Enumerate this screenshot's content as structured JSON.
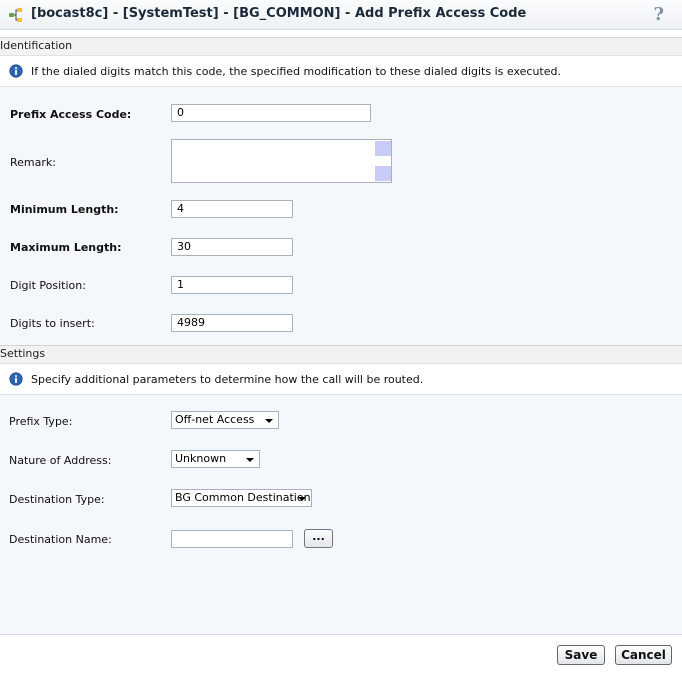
{
  "window": {
    "title": "[bocast8c] - [SystemTest] - [BG_COMMON] - Add Prefix Access Code",
    "help_symbol": "?"
  },
  "identification": {
    "header": "Identification",
    "info": "If the dialed digits match this code, the specified modification to these dialed digits is executed.",
    "prefix_access_code": {
      "label": "Prefix Access Code:",
      "value": "0"
    },
    "remark": {
      "label": "Remark:",
      "value": ""
    },
    "minimum_length": {
      "label": "Minimum Length:",
      "value": "4"
    },
    "maximum_length": {
      "label": "Maximum Length:",
      "value": "30"
    },
    "digit_position": {
      "label": "Digit Position:",
      "value": "1"
    },
    "digits_to_insert": {
      "label": "Digits to insert:",
      "value": "4989"
    }
  },
  "settings": {
    "header": "Settings",
    "info": "Specify additional parameters to determine how the call will be routed.",
    "prefix_type": {
      "label": "Prefix Type:",
      "value": "Off-net Access"
    },
    "nature_of_address": {
      "label": "Nature of Address:",
      "value": "Unknown"
    },
    "destination_type": {
      "label": "Destination Type:",
      "value": "BG Common Destination"
    },
    "destination_name": {
      "label": "Destination Name:",
      "value": "",
      "browse_label": "..."
    }
  },
  "footer": {
    "save_label": "Save",
    "cancel_label": "Cancel"
  },
  "colors": {
    "form_background": "#f4f7fb",
    "section_header": "#f2f2f2",
    "title_text": "#1b2a3a",
    "info_icon": "#2f64b4",
    "scrollbar": "#c7cbf5"
  }
}
